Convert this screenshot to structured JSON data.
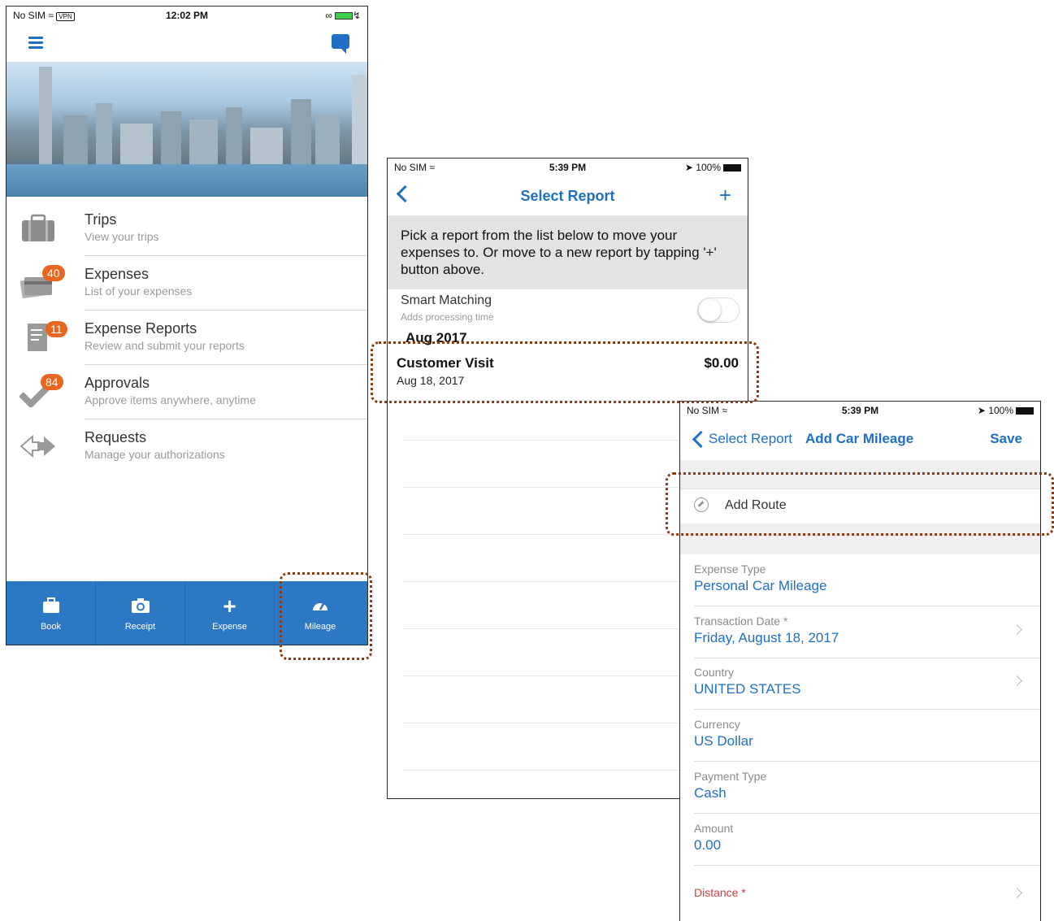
{
  "screen_home": {
    "status": {
      "carrier": "No SIM",
      "vpn": "VPN",
      "time": "12:02 PM"
    },
    "menu": [
      {
        "title": "Trips",
        "subtitle": "View your trips",
        "badge": "",
        "icon": "suitcase-icon"
      },
      {
        "title": "Expenses",
        "subtitle": "List of your expenses",
        "badge": "40",
        "icon": "card-icon"
      },
      {
        "title": "Expense Reports",
        "subtitle": "Review and submit your reports",
        "badge": "11",
        "icon": "document-icon"
      },
      {
        "title": "Approvals",
        "subtitle": "Approve items anywhere, anytime",
        "badge": "84",
        "icon": "checkmark-icon"
      },
      {
        "title": "Requests",
        "subtitle": "Manage your authorizations",
        "badge": "",
        "icon": "arrows-icon"
      }
    ],
    "tabs": [
      {
        "label": "Book",
        "icon": "suitcase-icon"
      },
      {
        "label": "Receipt",
        "icon": "camera-icon"
      },
      {
        "label": "Expense",
        "icon": "plus-icon"
      },
      {
        "label": "Mileage",
        "icon": "speedometer-icon"
      }
    ]
  },
  "screen_select_report": {
    "status": {
      "carrier": "No SIM",
      "time": "5:39 PM",
      "battery": "100%"
    },
    "title": "Select Report",
    "plus_label": "+",
    "info": "Pick a report from the list below to move your expenses to. Or move to a new report by tapping '+' button above.",
    "smart_matching": {
      "label": "Smart Matching",
      "sublabel": "Adds processing time",
      "enabled": false
    },
    "section": "Aug 2017",
    "report": {
      "name": "Customer Visit",
      "date": "Aug 18, 2017",
      "amount": "$0.00"
    }
  },
  "screen_add_mileage": {
    "status": {
      "carrier": "No SIM",
      "time": "5:39 PM",
      "battery": "100%"
    },
    "back_label": "Select Report",
    "title": "Add Car Mileage",
    "save_label": "Save",
    "add_route": "Add Route",
    "fields": [
      {
        "label": "Expense Type",
        "value": "Personal Car Mileage"
      },
      {
        "label": "Transaction Date *",
        "value": "Friday, August 18, 2017"
      },
      {
        "label": "Country",
        "value": "UNITED STATES"
      },
      {
        "label": "Currency",
        "value": "US Dollar"
      },
      {
        "label": "Payment Type",
        "value": "Cash"
      },
      {
        "label": "Amount",
        "value": "0.00"
      },
      {
        "label": "Distance *",
        "value": ""
      }
    ]
  },
  "colors": {
    "accent": "#1f6fc5",
    "tabbar": "#2c78c5",
    "badge": "#e8661f",
    "highlight": "#8b3a0f",
    "required": "#d04040"
  }
}
